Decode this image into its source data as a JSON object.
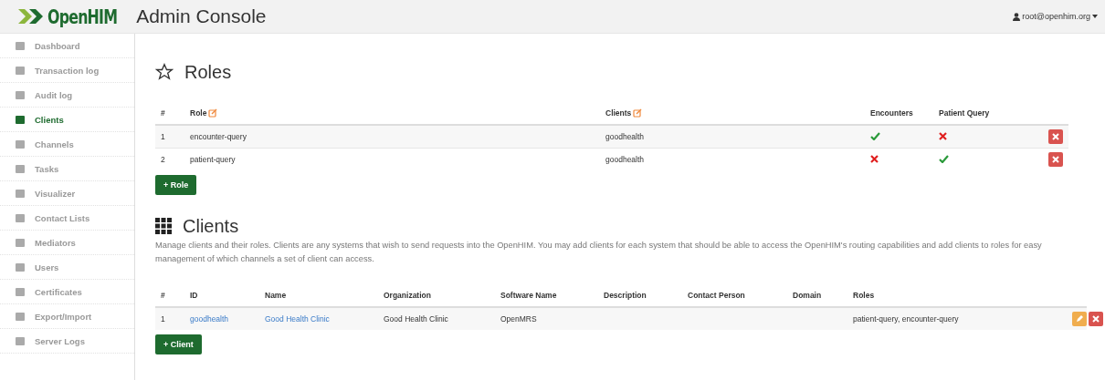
{
  "header": {
    "logo": "OpenHIM",
    "title": "Admin Console",
    "user": "root@openhim.org"
  },
  "sidebar": {
    "items": [
      {
        "label": "Dashboard",
        "selected": false
      },
      {
        "label": "Transaction log",
        "selected": false
      },
      {
        "label": "Audit log",
        "selected": false
      },
      {
        "label": "Clients",
        "selected": true
      },
      {
        "label": "Channels",
        "selected": false
      },
      {
        "label": "Tasks",
        "selected": false
      },
      {
        "label": "Visualizer",
        "selected": false
      },
      {
        "label": "Contact Lists",
        "selected": false
      },
      {
        "label": "Mediators",
        "selected": false
      },
      {
        "label": "Users",
        "selected": false
      },
      {
        "label": "Certificates",
        "selected": false
      },
      {
        "label": "Export/Import",
        "selected": false
      },
      {
        "label": "Server Logs",
        "selected": false
      }
    ]
  },
  "roles": {
    "title": "Roles",
    "columns": [
      "#",
      "Role",
      "Clients",
      "Encounters",
      "Patient Query"
    ],
    "rows": [
      {
        "num": "1",
        "role": "encounter-query",
        "clients": "goodhealth",
        "permissions": [
          true,
          false
        ]
      },
      {
        "num": "2",
        "role": "patient-query",
        "clients": "goodhealth",
        "permissions": [
          false,
          true
        ]
      }
    ],
    "add_button": "+ Role"
  },
  "clients": {
    "title": "Clients",
    "description": "Manage clients and their roles. Clients are any systems that wish to send requests into the OpenHIM. You may add clients for each system that should be able to access the OpenHIM's routing capabilities and add clients to roles for easy management of which channels a set of client can access.",
    "columns": [
      "#",
      "ID",
      "Name",
      "Organization",
      "Software Name",
      "Description",
      "Contact Person",
      "Domain",
      "Roles"
    ],
    "rows": [
      {
        "num": "1",
        "id": "goodhealth",
        "name": "Good Health Clinic",
        "organization": "Good Health Clinic",
        "software": "OpenMRS",
        "roles": "patient-query, encounter-query"
      }
    ],
    "add_button": "+ Client"
  }
}
